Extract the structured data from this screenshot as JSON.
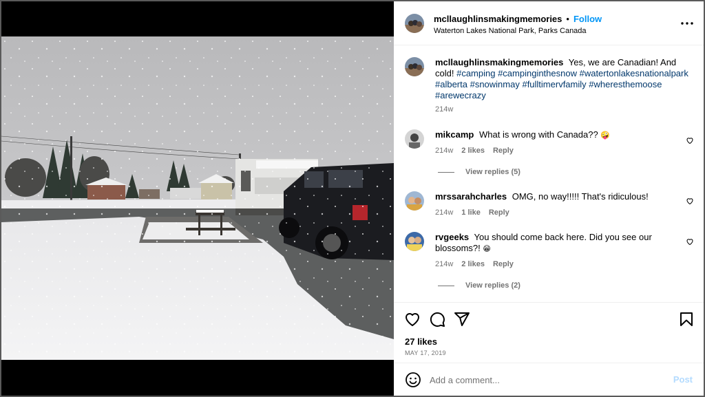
{
  "post": {
    "username": "mcllaughlinsmakingmemories",
    "follow_label": "Follow",
    "location": "Waterton Lakes National Park, Parks Canada",
    "separator": "•"
  },
  "caption": {
    "username": "mcllaughlinsmakingmemories",
    "text": "Yes, we are Canadian! And cold!",
    "hashtags": "#camping #campinginthesnow #watertonlakesnationalpark #alberta #snowinmay #fulltimervfamily #wheresthemoose #arewecrazy",
    "time": "214w"
  },
  "comments": [
    {
      "username": "mikcamp",
      "text": "What is wrong with Canada??",
      "emoji": "🤪",
      "time": "214w",
      "likes": "2 likes",
      "reply": "Reply",
      "view_replies": "View replies (5)"
    },
    {
      "username": "mrssarahcharles",
      "text": "OMG, no way!!!!! That's ridiculous!",
      "time": "214w",
      "likes": "1 like",
      "reply": "Reply"
    },
    {
      "username": "rvgeeks",
      "text": "You should come back here. Did you see our blossoms?!",
      "emoji": "😁",
      "time": "214w",
      "likes": "2 likes",
      "reply": "Reply",
      "view_replies": "View replies (2)"
    }
  ],
  "likes_count": "27 likes",
  "date": "MAY 17, 2019",
  "add_comment": {
    "placeholder": "Add a comment...",
    "post_label": "Post"
  },
  "icons": {
    "more": "more-icon",
    "like": "heart-icon",
    "comment": "comment-icon",
    "share": "share-icon",
    "save": "bookmark-icon",
    "emoji": "emoji-icon"
  },
  "colors": {
    "accent": "#0095f6",
    "hashtag": "#00376b",
    "secondary_text": "#737373",
    "post_disabled": "#b3dbff"
  }
}
